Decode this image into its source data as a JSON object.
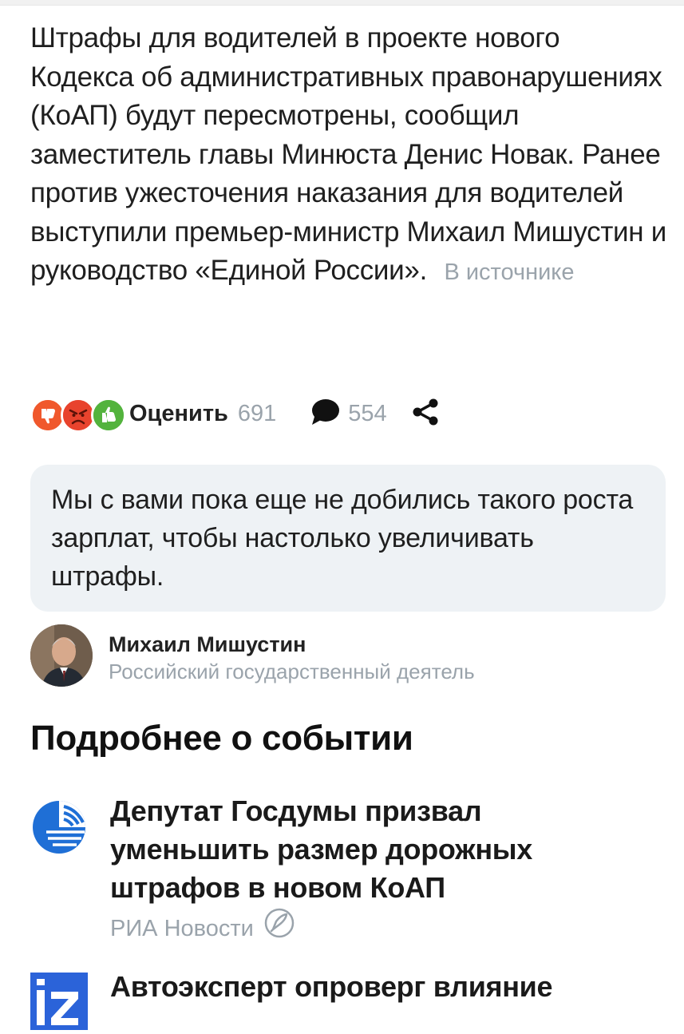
{
  "article": {
    "text": "Штрафы для водителей в проекте нового Кодекса об административных правонарушениях (КоАП) будут пересмотрены, сообщил заместитель главы Минюста Денис Новак. Ранее против ужесточения наказания для водителей выступили премьер-министр Михаил Мишустин и руководство «Единой России».",
    "source_link": "В источнике"
  },
  "actions": {
    "rate_label": "Оценить",
    "rate_count": "691",
    "comment_count": "554"
  },
  "quote": {
    "text": "Мы с вами пока еще не добились такого роста зарплат, чтобы настолько увеличивать штрафы."
  },
  "author": {
    "name": "Михаил Мишустин",
    "role": "Российский государственный деятель"
  },
  "section": {
    "title": "Подробнее о событии"
  },
  "news": [
    {
      "title": "Депутат Госдумы призвал уменьшить размер дорожных штрафов в новом КоАП",
      "source": "РИА Новости",
      "logo_icon": "ria-novosti-logo-icon"
    },
    {
      "title": "Автоэксперт опроверг влияние",
      "source": "",
      "logo_icon": "izvestia-logo-icon"
    }
  ],
  "icons": {
    "reactions": [
      "thumbs-down-icon",
      "angry-face-icon",
      "thumbs-up-icon"
    ],
    "comment": "speech-bubble-icon",
    "share": "share-icon",
    "ria_badge": "rocket-badge-icon"
  },
  "colors": {
    "thumbs_down": "#f0582c",
    "angry": "#e8432d",
    "thumbs_up": "#53b33d",
    "muted_text": "#9aa3ab",
    "quote_bg": "#eef2f5",
    "ria_blue": "#1f6fd6",
    "izvestia_blue": "#2b63d9"
  }
}
